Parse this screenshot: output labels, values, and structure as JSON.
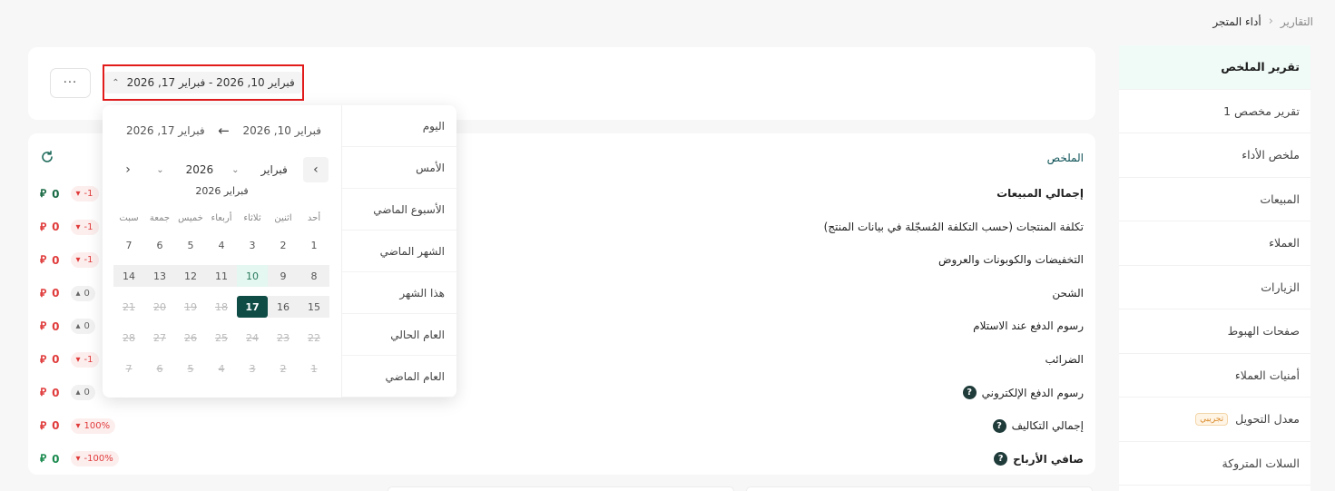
{
  "breadcrumb": {
    "root": "التقارير",
    "current": "أداء المتجر"
  },
  "sidebar": {
    "items": [
      {
        "label": "تقرير الملخص",
        "active": true
      },
      {
        "label": "تقرير مخصص 1"
      },
      {
        "label": "ملخص الأداء"
      },
      {
        "label": "المبيعات"
      },
      {
        "label": "العملاء"
      },
      {
        "label": "الزيارات"
      },
      {
        "label": "صفحات الهبوط"
      },
      {
        "label": "أمنيات العملاء"
      },
      {
        "label": "معدل التحويل",
        "badge": "تجريبي"
      },
      {
        "label": "السلات المتروكة"
      }
    ]
  },
  "filter": {
    "more_label": "···",
    "date_range": "فبراير 10, 2026  -  فبراير 17, 2026"
  },
  "summary": {
    "title": "الملخص",
    "currency_symbol": "⃁",
    "rows": [
      {
        "label": "إجمالي المبيعات",
        "bold": true,
        "value": "0",
        "change": "-1",
        "trend": "down",
        "value_color": "dark"
      },
      {
        "label": "تكلفة المنتجات (حسب التكلفة المُسجّلة في بيانات المنتج)",
        "value": "0",
        "change": "-1",
        "trend": "down",
        "value_color": "red"
      },
      {
        "label": "التخفيضات والكوبونات والعروض",
        "value": "0",
        "change": "-1",
        "trend": "down",
        "value_color": "red"
      },
      {
        "label": "الشحن",
        "value": "0",
        "change": "0",
        "trend": "up",
        "value_color": "red"
      },
      {
        "label": "رسوم الدفع عند الاستلام",
        "value": "0",
        "change": "0",
        "trend": "up",
        "value_color": "red"
      },
      {
        "label": "الضرائب",
        "value": "0",
        "change": "-1",
        "trend": "down",
        "value_color": "red"
      },
      {
        "label": "رسوم الدفع الإلكتروني",
        "help": true,
        "value": "0",
        "change": "0",
        "trend": "up",
        "value_color": "red"
      },
      {
        "label": "إجمالي التكاليف",
        "help": true,
        "value": "0",
        "change": "100%",
        "trend": "down",
        "value_color": "red"
      },
      {
        "label": "صافي الأرباح",
        "help": true,
        "bold": true,
        "value": "0",
        "change": "-100%",
        "trend": "down",
        "value_color": "green"
      }
    ]
  },
  "datepicker": {
    "presets": [
      "اليوم",
      "الأمس",
      "الأسبوع الماضي",
      "الشهر الماضي",
      "هذا الشهر",
      "العام الحالي",
      "العام الماضي"
    ],
    "range_start": "فبراير 10, 2026",
    "range_end": "فبراير 17, 2026",
    "month_select": "فبراير",
    "year_select": "2026",
    "month_title": "فبراير 2026",
    "weekdays": [
      "أحد",
      "اثنين",
      "ثلاثاء",
      "أربعاء",
      "خميس",
      "جمعة",
      "سبت"
    ],
    "weeks": [
      [
        "1",
        "2",
        "3",
        "4",
        "5",
        "6",
        "7"
      ],
      [
        "8",
        "9",
        "10",
        "11",
        "12",
        "13",
        "14"
      ],
      [
        "15",
        "16",
        "17",
        "18",
        "19",
        "20",
        "21"
      ],
      [
        "22",
        "23",
        "24",
        "25",
        "26",
        "27",
        "28"
      ],
      [
        "1",
        "2",
        "3",
        "4",
        "5",
        "6",
        "7"
      ]
    ],
    "selected_day": "17",
    "today_day": "10"
  }
}
